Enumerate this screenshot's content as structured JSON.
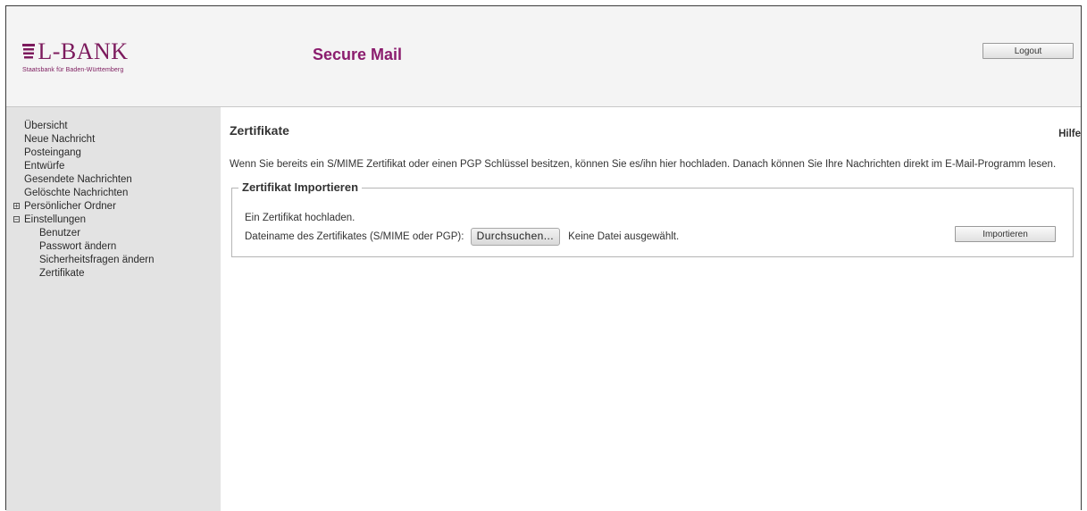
{
  "brand": {
    "logo_text": "L-BANK",
    "logo_subtitle": "Staatsbank für Baden-Württemberg",
    "accent_color": "#8b1d6e"
  },
  "header": {
    "app_title": "Secure Mail",
    "logout_label": "Logout"
  },
  "sidebar": {
    "items": [
      {
        "label": "Übersicht"
      },
      {
        "label": "Neue Nachricht"
      },
      {
        "label": "Posteingang"
      },
      {
        "label": "Entwürfe"
      },
      {
        "label": "Gesendete Nachrichten"
      },
      {
        "label": "Gelöschte Nachrichten"
      },
      {
        "label": "Persönlicher Ordner",
        "toggle": "+"
      },
      {
        "label": "Einstellungen",
        "toggle": "−"
      },
      {
        "label": "Benutzer"
      },
      {
        "label": "Passwort ändern"
      },
      {
        "label": "Sicherheitsfragen ändern"
      },
      {
        "label": "Zertifikate"
      }
    ]
  },
  "main": {
    "title": "Zertifikate",
    "help_label": "Hilfe",
    "intro_text": "Wenn Sie bereits ein S/MIME Zertifikat oder einen PGP Schlüssel besitzen, können Sie es/ihn hier hochladen. Danach können Sie Ihre Nachrichten direkt im E-Mail-Programm lesen.",
    "import_section": {
      "legend": "Zertifikat Importieren",
      "upload_hint": "Ein Zertifikat hochladen.",
      "file_label": "Dateiname des Zertifikates (S/MIME oder PGP):",
      "browse_label": "Durchsuchen...",
      "no_file_text": "Keine Datei ausgewählt.",
      "import_label": "Importieren"
    }
  }
}
